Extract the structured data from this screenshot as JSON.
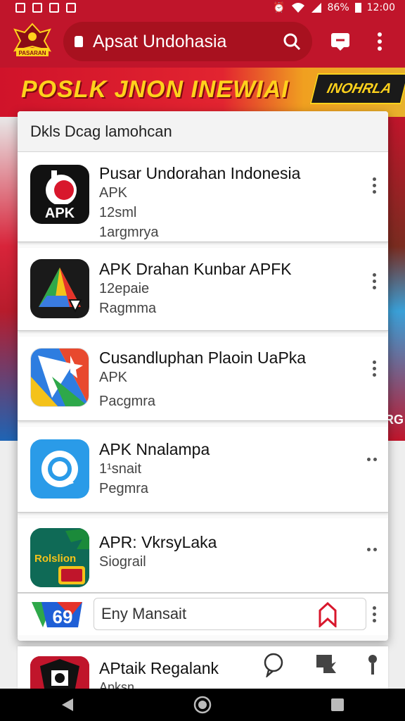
{
  "status_bar": {
    "battery": "86%",
    "time": "12:00"
  },
  "browser": {
    "site_name": "Apsat Undohasia",
    "site_logo_text": "PASARAN"
  },
  "banner": {
    "title": "POSLK JNON INEWIAI",
    "badge": "INOHRLA"
  },
  "background": {
    "right_label": "RG"
  },
  "sheet": {
    "header": "Dkls Dcag lamohcan",
    "apps": [
      {
        "name": "Pusar Undorahan Indonesia",
        "line1": "APK",
        "line2": "12sml",
        "line3": "1argmrya",
        "icon": "apk-logo-icon"
      },
      {
        "name": "APK Drahan Kunbar APFK",
        "line1": "12epaie",
        "line2": "Ragmma",
        "icon": "triangle-play-icon"
      },
      {
        "name": "Cusandluphan Plaoin UaPka",
        "line1": "APK",
        "line2": "Pacgmra",
        "icon": "map-flag-icon"
      },
      {
        "name": "APK Nnalampa",
        "line1": "1¹snait",
        "line2": "Pegmra",
        "icon": "ring-icon"
      },
      {
        "name": "APR: VkrsyLaka",
        "line1": "Siograil",
        "icon": "casino-game-icon",
        "icon_text": "Rolslion"
      }
    ],
    "search": {
      "value": "Eny Mansait",
      "logo_text": "69"
    }
  },
  "partial_item": {
    "name": "APtaik Regalank",
    "sub": "Apksn"
  },
  "colors": {
    "brand_red": "#c0152b",
    "banner_yellow": "#ffd21c"
  }
}
